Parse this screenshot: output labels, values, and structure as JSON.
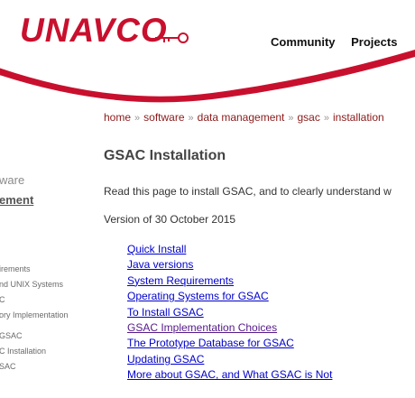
{
  "logo": {
    "text": "UNAVCO",
    "brand_color": "#c8102e"
  },
  "topnav": {
    "items": [
      "Community",
      "Projects"
    ]
  },
  "sidebar": {
    "title": "ware",
    "subtitle": "ement",
    "links": [
      "irements",
      "nd UNIX Systems",
      "C",
      "ory Implementation",
      "GSAC",
      "C Installation",
      "SAC"
    ]
  },
  "breadcrumb": {
    "items": [
      "home",
      "software",
      "data management",
      "gsac",
      "installation"
    ],
    "separator": "»"
  },
  "main": {
    "title": "GSAC Installation",
    "intro": "Read this page to install GSAC, and to clearly understand w",
    "version": "Version of 30 October 2015",
    "toc": [
      "Quick Install",
      "Java versions",
      "System Requirements",
      "Operating Systems for GSAC",
      "To Install GSAC",
      "GSAC Implementation Choices",
      "The Prototype Database for GSAC",
      "Updating GSAC",
      "More about GSAC, and What GSAC is Not"
    ]
  },
  "colors": {
    "link": "#0000cc",
    "visited_link": "#551a8b",
    "breadcrumb": "#8b1a1a",
    "swoosh": "#c8102e"
  }
}
